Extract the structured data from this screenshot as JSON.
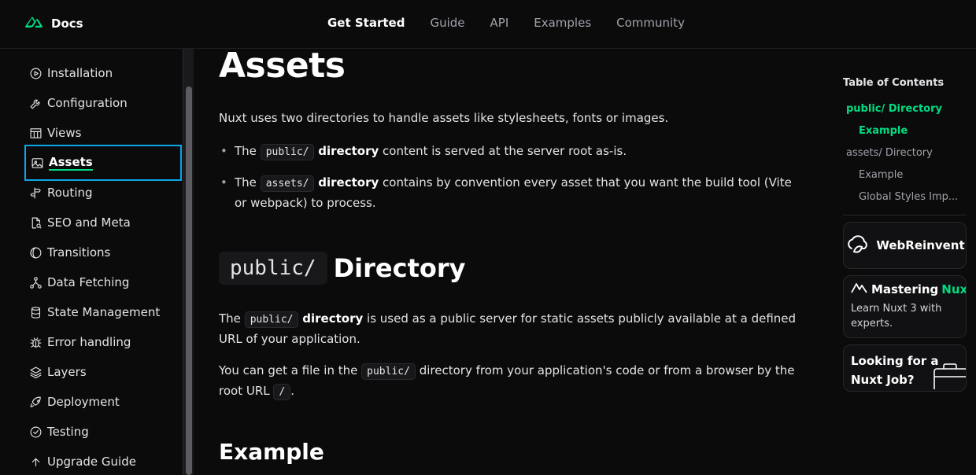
{
  "header": {
    "logo_text": "Docs",
    "nav": [
      {
        "label": "Get Started",
        "active": true
      },
      {
        "label": "Guide",
        "active": false
      },
      {
        "label": "API",
        "active": false
      },
      {
        "label": "Examples",
        "active": false
      },
      {
        "label": "Community",
        "active": false
      }
    ]
  },
  "sidebar": {
    "items": [
      {
        "label": "Installation",
        "icon": "play-circle-icon"
      },
      {
        "label": "Configuration",
        "icon": "wrench-icon"
      },
      {
        "label": "Views",
        "icon": "table-layout-icon"
      },
      {
        "label": "Assets",
        "icon": "image-icon",
        "active": true
      },
      {
        "label": "Routing",
        "icon": "signpost-icon"
      },
      {
        "label": "SEO and Meta",
        "icon": "file-search-icon"
      },
      {
        "label": "Transitions",
        "icon": "half-circle-icon"
      },
      {
        "label": "Data Fetching",
        "icon": "network-icon"
      },
      {
        "label": "State Management",
        "icon": "database-icon"
      },
      {
        "label": "Error handling",
        "icon": "bug-icon"
      },
      {
        "label": "Layers",
        "icon": "layers-icon"
      },
      {
        "label": "Deployment",
        "icon": "rocket-icon"
      },
      {
        "label": "Testing",
        "icon": "check-circle-icon"
      },
      {
        "label": "Upgrade Guide",
        "icon": "arrow-up-icon"
      }
    ]
  },
  "main": {
    "title": "Assets",
    "intro": "Nuxt uses two directories to handle assets like stylesheets, fonts or images.",
    "bullet1": {
      "pre": "The",
      "code": "public/",
      "bold": "directory",
      "post": "content is served at the server root as-is."
    },
    "bullet2": {
      "pre": "The",
      "code": "assets/",
      "bold": "directory",
      "post": "contains by convention every asset that you want the build tool (Vite or webpack) to process."
    },
    "section_heading": {
      "code": "public/",
      "text": "Directory"
    },
    "para1": {
      "pre": "The",
      "code": "public/",
      "bold": "directory",
      "post": "is used as a public server for static assets publicly available at a defined URL of your application."
    },
    "para2": {
      "pre": "You can get a file in the",
      "code": "public/",
      "mid": "directory from your application's code or from a browser by the root URL",
      "code2": "/",
      "post": "."
    },
    "example_heading": "Example"
  },
  "toc": {
    "title": "Table of Contents",
    "items": [
      {
        "label": "public/ Directory",
        "active": true
      },
      {
        "label": "Example",
        "active": true
      },
      {
        "label": "assets/ Directory",
        "active": false
      },
      {
        "label": "Example",
        "active": false
      },
      {
        "label": "Global Styles Imp...",
        "active": false
      }
    ]
  },
  "ads": {
    "webreinvent": "WebReinvent",
    "mastering_prefix": "Mastering",
    "mastering_accent": "Nuxt",
    "mastering_sub": "Learn Nuxt 3 with experts.",
    "job": "Looking for a Nuxt Job?"
  },
  "colors": {
    "accent": "#00dc82",
    "focus_ring": "#0ea5e9",
    "background": "#0b0b0c"
  }
}
